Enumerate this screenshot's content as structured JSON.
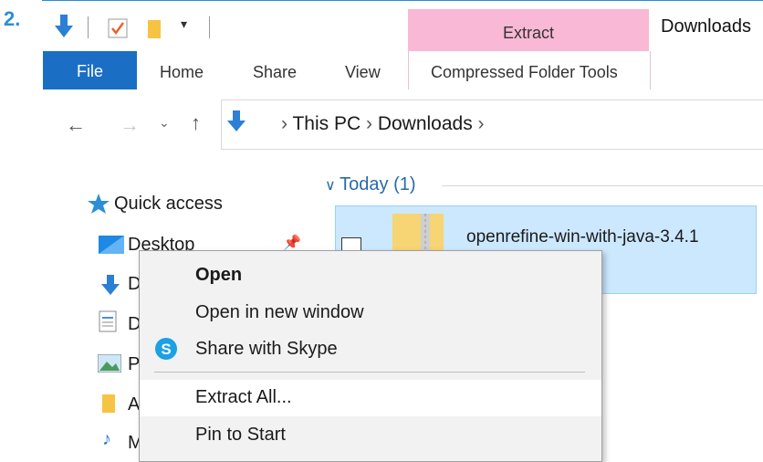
{
  "step_number": "2.",
  "window": {
    "title": "Downloads"
  },
  "ribbon": {
    "contextual_header": "Extract",
    "tabs": [
      {
        "label": "File"
      },
      {
        "label": "Home"
      },
      {
        "label": "Share"
      },
      {
        "label": "View"
      },
      {
        "label": "Compressed Folder Tools"
      }
    ]
  },
  "address_bar": {
    "path": [
      "This PC",
      "Downloads"
    ]
  },
  "nav_pane": {
    "quick_access": "Quick access",
    "items": [
      {
        "label": "Desktop"
      },
      {
        "label": "D"
      },
      {
        "label": "D"
      },
      {
        "label": "P"
      },
      {
        "label": "A"
      },
      {
        "label": "M"
      }
    ]
  },
  "content": {
    "group_header": "Today (1)",
    "file": {
      "name": "openrefine-win-with-java-3.4.1"
    }
  },
  "context_menu": {
    "items": [
      {
        "label": "Open"
      },
      {
        "label": "Open in new window"
      },
      {
        "label": "Share with Skype"
      },
      {
        "label": "Extract All..."
      },
      {
        "label": "Pin to Start"
      }
    ]
  },
  "icons": {
    "quick_access_star": "star-icon",
    "down_arrow": "download-arrow-icon",
    "skype": "skype-icon"
  },
  "colors": {
    "accent": "#1a6fc4",
    "contextual": "#f9b8d5",
    "selection": "#cce8ff",
    "step": "#2b8ed8"
  }
}
